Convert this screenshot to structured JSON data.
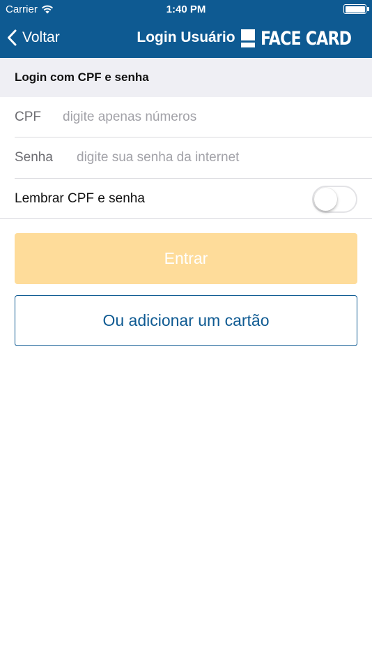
{
  "status_bar": {
    "carrier": "Carrier",
    "time": "1:40 PM"
  },
  "nav": {
    "back_label": "Voltar",
    "title": "Login Usuário",
    "brand": "FACE CARD"
  },
  "section": {
    "title": "Login com CPF e senha"
  },
  "form": {
    "cpf_label": "CPF",
    "cpf_placeholder": "digite apenas números",
    "cpf_value": "",
    "senha_label": "Senha",
    "senha_placeholder": "digite sua senha da internet",
    "senha_value": "",
    "remember_label": "Lembrar CPF e senha",
    "remember_on": false
  },
  "buttons": {
    "login": "Entrar",
    "add_card": "Ou adicionar um cartão"
  },
  "colors": {
    "nav_background": "#0e5a92",
    "section_background": "#efeff4",
    "login_button_disabled": "#fedc9a",
    "accent": "#0e5a92"
  },
  "icons": [
    "wifi-icon",
    "battery-icon",
    "chevron-left-icon",
    "face-card-logo-icon"
  ]
}
